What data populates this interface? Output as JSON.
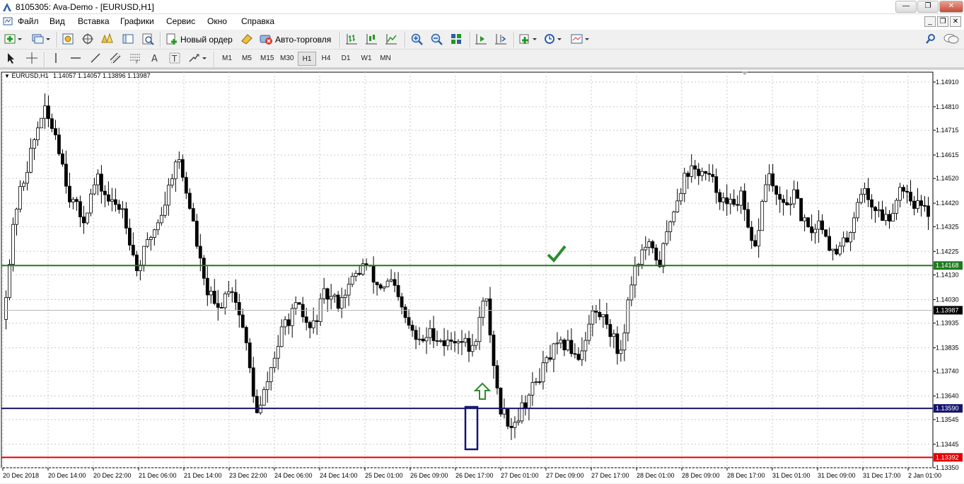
{
  "window": {
    "title": "8105305: Ava-Demo - [EURUSD,H1]",
    "minimize_glyph": "—",
    "maximize_glyph": "❐",
    "close_glyph": "✕"
  },
  "menu": {
    "items": [
      "Файл",
      "Вид",
      "Вставка",
      "Графики",
      "Сервис",
      "Окно",
      "Справка"
    ]
  },
  "mdi": {
    "minimize": "_",
    "restore": "❐",
    "close": "✕"
  },
  "toolbar": {
    "new_order": "Новый ордер",
    "auto_trading": "Авто-торговля",
    "icons": [
      "new-chart-icon",
      "profiles-icon",
      "market-watch-icon",
      "navigator-icon",
      "data-window-icon",
      "terminal-icon",
      "strategy-tester-icon",
      "new-order-icon",
      "meta-editor-icon",
      "auto-trading-icon",
      "bar-chart-icon",
      "candlestick-icon",
      "line-chart-icon",
      "zoom-in-icon",
      "zoom-out-icon",
      "tile-windows-icon",
      "autoscroll-icon",
      "chart-shift-icon",
      "indicators-icon",
      "periods-icon",
      "templates-icon",
      "search-icon",
      "chat-icon"
    ]
  },
  "drawing_tools": {
    "icons": [
      "cursor-icon",
      "crosshair-icon",
      "vertical-line-icon",
      "horizontal-line-icon",
      "trendline-icon",
      "equidistant-channel-icon",
      "fibonacci-icon",
      "text-icon",
      "text-label-icon",
      "arrows-icon"
    ],
    "timeframes": [
      "M1",
      "M5",
      "M15",
      "M30",
      "H1",
      "H4",
      "D1",
      "W1",
      "MN"
    ],
    "active_timeframe": "H1"
  },
  "chart_data": {
    "type": "candlestick",
    "symbol_label": "EURUSD,H1",
    "ohlc_label": "1.14057 1.14057 1.13896 1.13987",
    "ylim": [
      1.1335,
      1.1495
    ],
    "y_ticks": [
      "1.14910",
      "1.14810",
      "1.14715",
      "1.14615",
      "1.14520",
      "1.14420",
      "1.14325",
      "1.14225",
      "1.14130",
      "1.14030",
      "1.13935",
      "1.13835",
      "1.13740",
      "1.13640",
      "1.13545",
      "1.13445",
      "1.13350"
    ],
    "x_ticks": [
      "20 Dec 2018",
      "20 Dec 14:00",
      "20 Dec 22:00",
      "21 Dec 06:00",
      "21 Dec 14:00",
      "23 Dec 22:00",
      "24 Dec 06:00",
      "24 Dec 14:00",
      "25 Dec 01:00",
      "26 Dec 09:00",
      "26 Dec 17:00",
      "27 Dec 01:00",
      "27 Dec 09:00",
      "27 Dec 17:00",
      "28 Dec 01:00",
      "28 Dec 09:00",
      "28 Dec 17:00",
      "31 Dec 01:00",
      "31 Dec 09:00",
      "31 Dec 17:00",
      "2 Jan 01:00"
    ],
    "levels": [
      {
        "value": 1.14168,
        "label": "1.14168",
        "color": "#1e7a1e"
      },
      {
        "value": 1.1359,
        "label": "1.13590",
        "color": "#14146e"
      },
      {
        "value": 1.13392,
        "label": "1.13392",
        "color": "#e00000"
      }
    ],
    "bid": {
      "value": 1.13987,
      "label": "1.13987",
      "color": "#000000"
    },
    "bull_color": "#ffffff",
    "bear_color": "#000000",
    "check_color": "#2e8b2e",
    "arrow_color": "#2e8b2e",
    "box_color": "#14146e",
    "anchors": [
      1.1395,
      1.144,
      1.146,
      1.148,
      1.147,
      1.1445,
      1.1435,
      1.1452,
      1.1442,
      1.144,
      1.1415,
      1.1428,
      1.144,
      1.1462,
      1.144,
      1.141,
      1.1398,
      1.141,
      1.139,
      1.1355,
      1.1375,
      1.1393,
      1.14,
      1.139,
      1.1405,
      1.1402,
      1.141,
      1.1418,
      1.1408,
      1.141,
      1.1395,
      1.1385,
      1.139,
      1.1385,
      1.1388,
      1.1382,
      1.1405,
      1.136,
      1.1352,
      1.1362,
      1.1372,
      1.1382,
      1.1385,
      1.138,
      1.1398,
      1.1395,
      1.138,
      1.1415,
      1.1425,
      1.1418,
      1.144,
      1.1455,
      1.1455,
      1.145,
      1.144,
      1.1445,
      1.142,
      1.1455,
      1.144,
      1.1445,
      1.143,
      1.1435,
      1.142,
      1.1428,
      1.1448,
      1.144,
      1.1435,
      1.145,
      1.1442,
      1.1438
    ],
    "seed": 42
  }
}
